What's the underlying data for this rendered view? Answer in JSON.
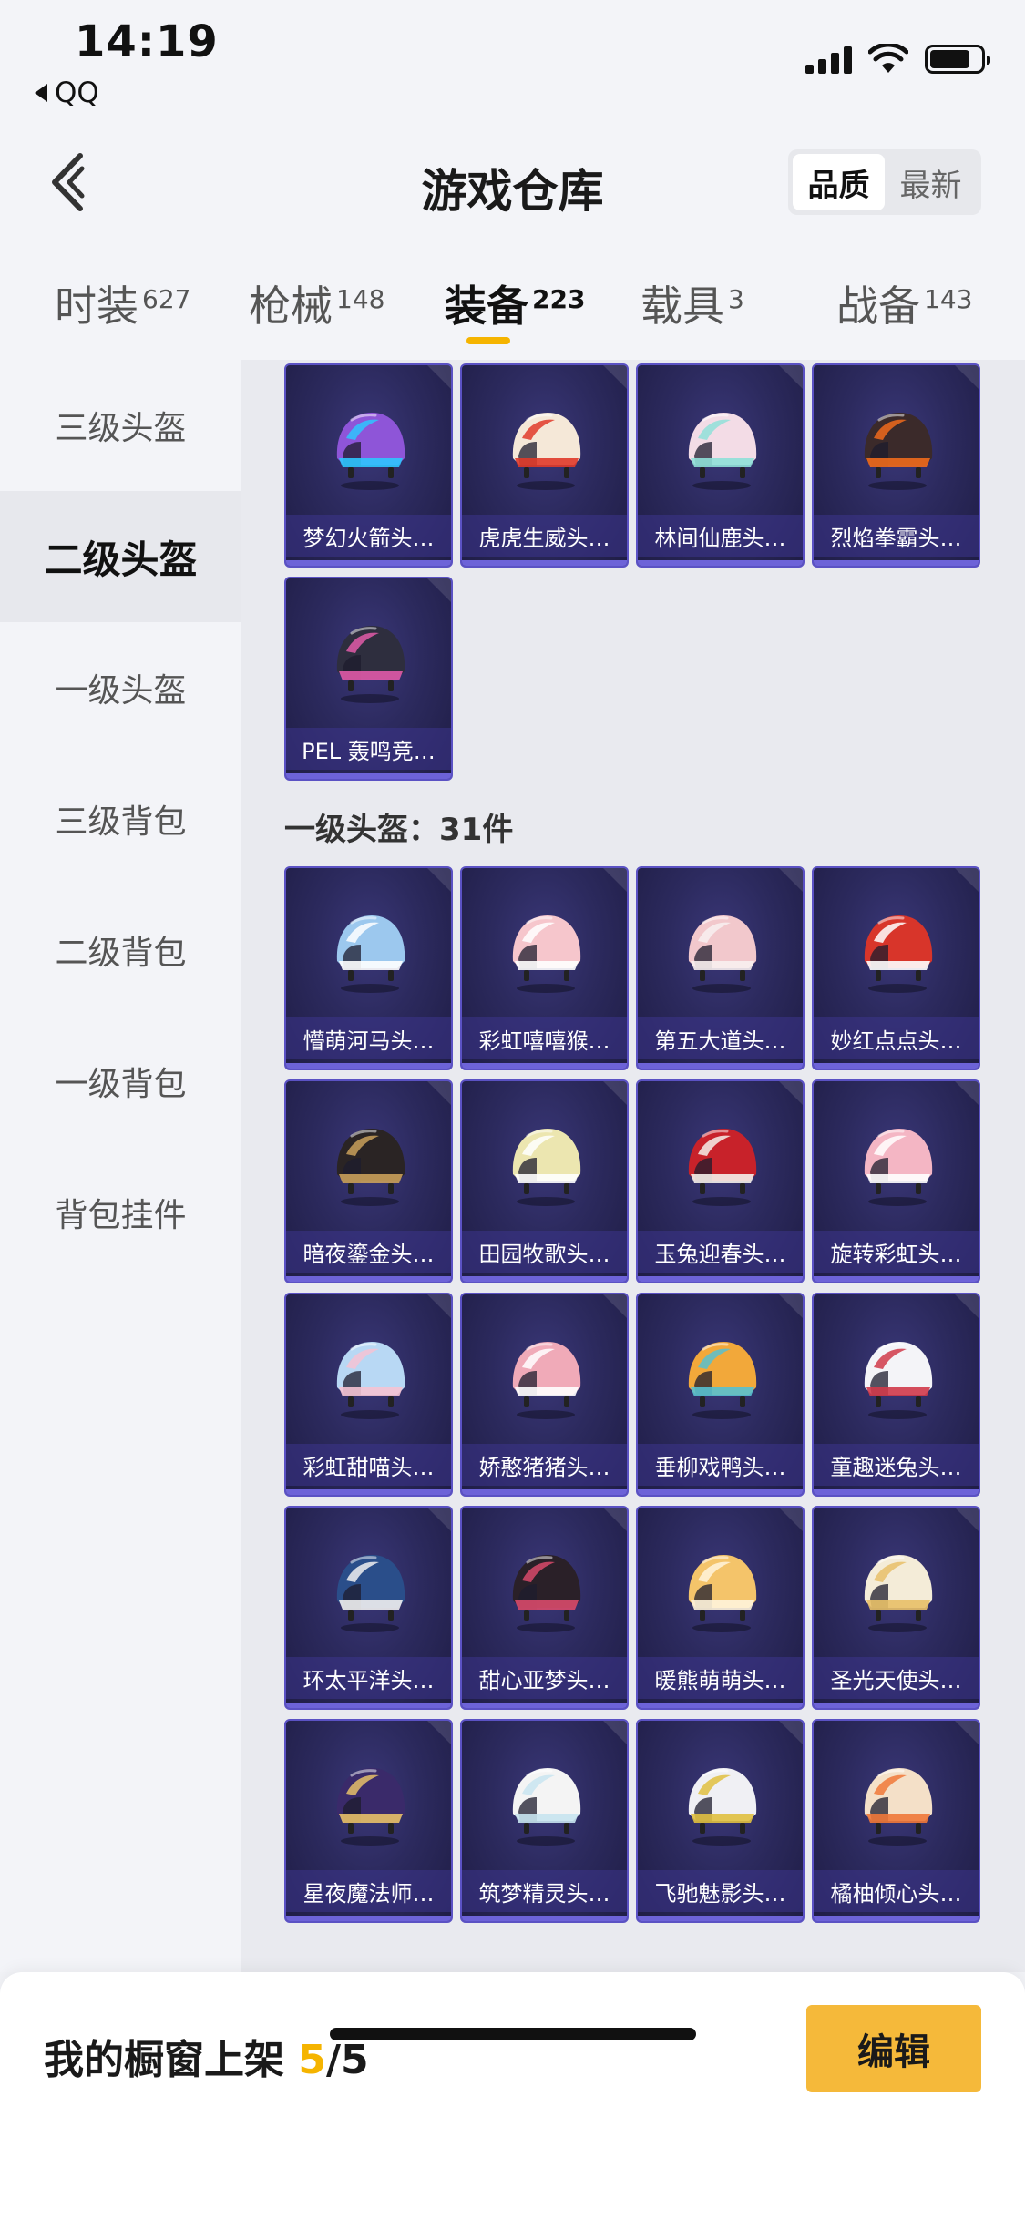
{
  "status_bar": {
    "time": "14:19",
    "back_app": "QQ"
  },
  "nav": {
    "title": "游戏仓库",
    "sort_options": [
      "品质",
      "最新"
    ],
    "active_sort": "品质"
  },
  "tabs": [
    {
      "label": "时装",
      "count": "627"
    },
    {
      "label": "枪械",
      "count": "148"
    },
    {
      "label": "装备",
      "count": "223",
      "active": true
    },
    {
      "label": "载具",
      "count": "3"
    },
    {
      "label": "战备",
      "count": "143"
    }
  ],
  "sidebar": {
    "items": [
      "三级头盔",
      "二级头盔",
      "一级头盔",
      "三级背包",
      "二级背包",
      "一级背包",
      "背包挂件"
    ],
    "active": "二级头盔"
  },
  "level2": {
    "items": [
      {
        "name": "梦幻火箭头…",
        "colors": [
          "#8e55d8",
          "#2ec6ff"
        ]
      },
      {
        "name": "虎虎生威头…",
        "colors": [
          "#f5e8d8",
          "#e03a2a"
        ]
      },
      {
        "name": "林间仙鹿头…",
        "colors": [
          "#f3dce6",
          "#8fe0d8"
        ]
      },
      {
        "name": "烈焰拳霸头…",
        "colors": [
          "#3b2a2a",
          "#f06a1c"
        ]
      },
      {
        "name": "PEL 轰鸣竞…",
        "colors": [
          "#2e2e3e",
          "#e05aa8"
        ]
      }
    ]
  },
  "level1": {
    "header": "一级头盔：31件",
    "items": [
      {
        "name": "懵萌河马头…",
        "colors": [
          "#9cc8ee",
          "#ffffff"
        ]
      },
      {
        "name": "彩虹嘻嘻猴…",
        "colors": [
          "#f6c6cc",
          "#ffffff"
        ]
      },
      {
        "name": "第五大道头…",
        "colors": [
          "#f2c8cc",
          "#f8f0f0"
        ]
      },
      {
        "name": "妙红点点头…",
        "colors": [
          "#d8352a",
          "#ffffff"
        ]
      },
      {
        "name": "暗夜鎏金头…",
        "colors": [
          "#2a2424",
          "#c9a05a"
        ]
      },
      {
        "name": "田园牧歌头…",
        "colors": [
          "#ece6b0",
          "#ffffff"
        ]
      },
      {
        "name": "玉兔迎春头…",
        "colors": [
          "#c8222a",
          "#f4f0ea"
        ]
      },
      {
        "name": "旋转彩虹头…",
        "colors": [
          "#f4b6c4",
          "#ffffff"
        ]
      },
      {
        "name": "彩虹甜喵头…",
        "colors": [
          "#b8d8f4",
          "#f5c3d3"
        ]
      },
      {
        "name": "娇憨猪猪头…",
        "colors": [
          "#f0aab8",
          "#ffffff"
        ]
      },
      {
        "name": "垂柳戏鸭头…",
        "colors": [
          "#f2a83a",
          "#58c0d0"
        ]
      },
      {
        "name": "童趣迷兔头…",
        "colors": [
          "#f4f4f8",
          "#d03a4a"
        ]
      },
      {
        "name": "环太平洋头…",
        "colors": [
          "#2a4e8a",
          "#f0f0f0"
        ]
      },
      {
        "name": "甜心亚梦头…",
        "colors": [
          "#2a2028",
          "#d84a6a"
        ]
      },
      {
        "name": "暖熊萌萌头…",
        "colors": [
          "#f4c46a",
          "#fff4dc"
        ]
      },
      {
        "name": "圣光天使头…",
        "colors": [
          "#f4ecd8",
          "#e8c068"
        ]
      },
      {
        "name": "星夜魔法师…",
        "colors": [
          "#3a2a6a",
          "#e8c068"
        ]
      },
      {
        "name": "筑梦精灵头…",
        "colors": [
          "#f4f4f4",
          "#c8e4f0"
        ]
      },
      {
        "name": "飞驰魅影头…",
        "colors": [
          "#f0f0f4",
          "#e0c040"
        ]
      },
      {
        "name": "橘柚倾心头…",
        "colors": [
          "#f4e0c8",
          "#f07838"
        ]
      }
    ]
  },
  "bottom": {
    "prefix": "我的橱窗上架 ",
    "current": "5",
    "total": "/5",
    "edit_label": "编辑"
  }
}
